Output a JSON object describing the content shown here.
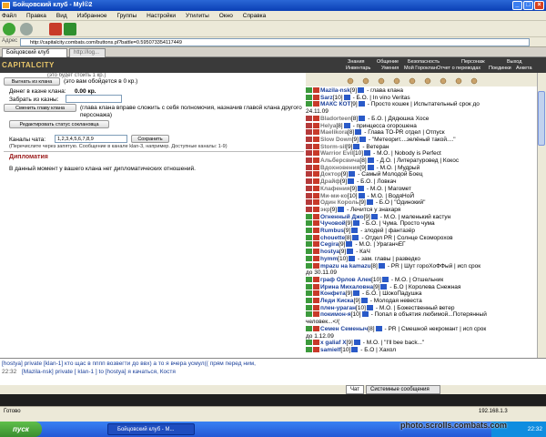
{
  "window": {
    "title": "Бойцовский клуб - Myl©2"
  },
  "menu": {
    "items": [
      "Файл",
      "Правка",
      "Вид",
      "Избранное",
      "Группы",
      "Настройки",
      "Утилиты",
      "Окно",
      "Справка"
    ]
  },
  "address": {
    "label": "Адрес",
    "url": "http://capitalcity.combats.com/buttons.pl?battle=0.595073354117449"
  },
  "tabs": {
    "items": [
      "Бойцовский клуб",
      "http://log..."
    ]
  },
  "game": {
    "logo": "CAPITALCITY",
    "nav_top": [
      "Знания",
      "Общение",
      "Безопасность",
      "Персонаж",
      "Выход"
    ],
    "nav_bottom": [
      "Инвентарь",
      "Умения",
      "Мой Гороклан",
      "Отчет о переводах",
      "Поединки",
      "Анкета"
    ]
  },
  "clan": {
    "withdraw_button": "Выгнать из клана",
    "top_note": "(это будет стоить 1 кр.)",
    "recruit_note": "(это вам обойдется в 0 кр.)",
    "balance_label": "Денег в казне клана:",
    "balance_value": "0.00 кр.",
    "take_label": "Забрать из казны:",
    "change_head_button": "Сменить главу клана",
    "change_head_note": "(глава клана вправе сложить с себя полномочия, назначив главой клана другого персонажа)",
    "edit_status_button": "Редактировать статус соклановца",
    "channels_label": "Каналы чата:",
    "channels_value": "1,2,3,4,5,6,7,8,9",
    "save_button": "Сохранить",
    "channels_note": "(Перечислите через запятую. Сообщение в канале klan-3, например. Доступные каналы: 1-9)",
    "diplomacy_title": "Дипломатия",
    "diplomacy_text": "В данный момент у вашего клана нет дипломатических отношений."
  },
  "members": [
    {
      "nick": "Mazila-nsk",
      "lvl": "[9]",
      "status": "- глава клана",
      "online": true
    },
    {
      "nick": "Sarz",
      "lvl": "[10]",
      "status": "- Б.О. | In vino Veritas",
      "online": true
    },
    {
      "nick": "МАКС КОТ",
      "lvl": "[9]",
      "status": "- Просто кошек | Испытательный срок до",
      "online": true
    },
    {
      "nick": "",
      "lvl": "",
      "status": "24.11.09",
      "online": true
    },
    {
      "nick": "Bladorteen",
      "lvl": "[8]",
      "status": "- Б.О. | Дядюшка Хосе",
      "online": false
    },
    {
      "nick": "Helya",
      "lvl": "[8]",
      "status": "- принцесса огорошена",
      "online": false
    },
    {
      "nick": "Maelikora",
      "lvl": "[8]",
      "status": "- Глава ТО-PR отдел | Отпуск",
      "online": false
    },
    {
      "nick": "Slow Down",
      "lvl": "[9]",
      "status": "- \"Метеорит....зелёный такой....\"",
      "online": false
    },
    {
      "nick": "Storm-sil",
      "lvl": "[9]",
      "status": "- Ветеран",
      "online": false
    },
    {
      "nick": "Warrior Evil",
      "lvl": "[10]",
      "status": "- М.О. | Nobody is Perfect",
      "online": false
    },
    {
      "nick": "Альберсвича",
      "lvl": "[8]",
      "status": "- Д.О. | Литературовед | Кокос",
      "online": false
    },
    {
      "nick": "Вдохновения",
      "lvl": "[9]",
      "status": "- М.О. | Мудрый",
      "online": false
    },
    {
      "nick": "Доктор",
      "lvl": "[9]",
      "status": "- Самый Молодой Боец",
      "online": false
    },
    {
      "nick": "Драйф",
      "lvl": "[9]",
      "status": "- Б.О. | Ловкач",
      "online": false
    },
    {
      "nick": "Клафения",
      "lvl": "[9]",
      "status": "- М.О. | Магомет",
      "online": false
    },
    {
      "nick": "Ми-ми-ко",
      "lvl": "[10]",
      "status": "- М.О. | ВодяНоЙ",
      "online": false
    },
    {
      "nick": "Один Король",
      "lvl": "[9]",
      "status": "- Б.О | \"Одинокий\"",
      "online": false
    },
    {
      "nick": "экр",
      "lvl": "[9]",
      "status": "- Лечится у знахаря",
      "online": false
    },
    {
      "nick": "Огненный Джо",
      "lvl": "[9]",
      "status": "- М.О. | маленький кастун",
      "online": true
    },
    {
      "nick": "Чучовой",
      "lvl": "[9]",
      "status": "- Б.О. | Чума. Просто чума",
      "online": true
    },
    {
      "nick": "Rumbus",
      "lvl": "[9]",
      "status": "- злодей | фантазёр",
      "online": true
    },
    {
      "nick": "chouette",
      "lvl": "[8]",
      "status": "- Отдел PR | Солнце Скоморохов",
      "online": true
    },
    {
      "nick": "Cegira",
      "lvl": "[9]",
      "status": "- М.О. | УраганчЕГ",
      "online": true
    },
    {
      "nick": "hostya",
      "lvl": "[9]",
      "status": "- КаЧ",
      "online": true
    },
    {
      "nick": "hymm",
      "lvl": "[10]",
      "status": "- зам. главы | разведко",
      "online": true
    },
    {
      "nick": "mpazu на kamazu",
      "lvl": "[8]",
      "status": "- PR | Шут гороХоФФый | исп срок",
      "online": true
    },
    {
      "nick": "",
      "lvl": "",
      "status": "до 30.11.09",
      "online": true
    },
    {
      "nick": "граф Орлов Алек",
      "lvl": "[10]",
      "status": "- М.О. | Отшельник",
      "online": true
    },
    {
      "nick": "Ирина Михаловна",
      "lvl": "[9]",
      "status": "- Б.О | Королева Снежная",
      "online": true
    },
    {
      "nick": "Конфета",
      "lvl": "[9]",
      "status": "- Б.О. | ШокоПадушка",
      "online": true
    },
    {
      "nick": "Леди Киска",
      "lvl": "[9]",
      "status": "- Молодая невеста",
      "online": true
    },
    {
      "nick": "плен-ураган",
      "lvl": "[10]",
      "status": "- М.О. | Божественный ветер",
      "online": true
    },
    {
      "nick": "покимон-я",
      "lvl": "[10]",
      "status": "- Попал в объятия любимой...Потерянный",
      "online": true
    },
    {
      "nick": "",
      "lvl": "",
      "status": "человек...</(",
      "online": true
    },
    {
      "nick": "Семен Семеныч",
      "lvl": "[8]",
      "status": "- PR | Смешной некромант | исп срок",
      "online": true
    },
    {
      "nick": "",
      "lvl": "",
      "status": "до 1.12.09",
      "online": true
    },
    {
      "nick": "x galiaf X",
      "lvl": "[9]",
      "status": "- М.О. | \"I'll bee back...\"",
      "online": true
    },
    {
      "nick": "samielf",
      "lvl": "[10]",
      "status": "- Б.О | Хахол",
      "online": true
    }
  ],
  "chat": {
    "line1": "[hostya] private [klan-1] кто щас в пппп возвегти до ввх) а то я вчера усмул(( прям перед ним,",
    "line2_time": "22:32",
    "line2": "[Mazila-nsk] private [ klan-1 ] to [hostya] я качаться, Костя",
    "tabs": [
      "Чат",
      "Системные сообщения"
    ]
  },
  "status": {
    "text": "Готово",
    "ip": "192.168.1.3"
  },
  "taskbar": {
    "start": "пуск",
    "task": "Бойцовский клуб - М...",
    "clock": "22:32"
  },
  "watermark": "photo.scrolls.combats.com"
}
